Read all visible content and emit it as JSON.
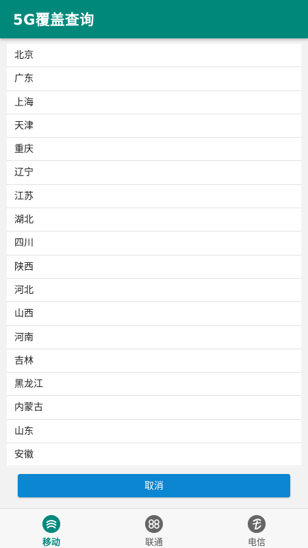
{
  "header": {
    "title": "5G覆盖查询"
  },
  "provinces": [
    "北京",
    "广东",
    "上海",
    "天津",
    "重庆",
    "辽宁",
    "江苏",
    "湖北",
    "四川",
    "陕西",
    "河北",
    "山西",
    "河南",
    "吉林",
    "黑龙江",
    "内蒙古",
    "山东",
    "安徽"
  ],
  "cancel_label": "取消",
  "nav": {
    "items": [
      {
        "label": "移动",
        "icon": "china-mobile-icon",
        "active": true
      },
      {
        "label": "联通",
        "icon": "china-unicom-icon",
        "active": false
      },
      {
        "label": "电信",
        "icon": "china-telecom-icon",
        "active": false
      }
    ]
  },
  "colors": {
    "primary": "#00897b",
    "button": "#0b86d1",
    "inactive_icon": "#666666"
  }
}
